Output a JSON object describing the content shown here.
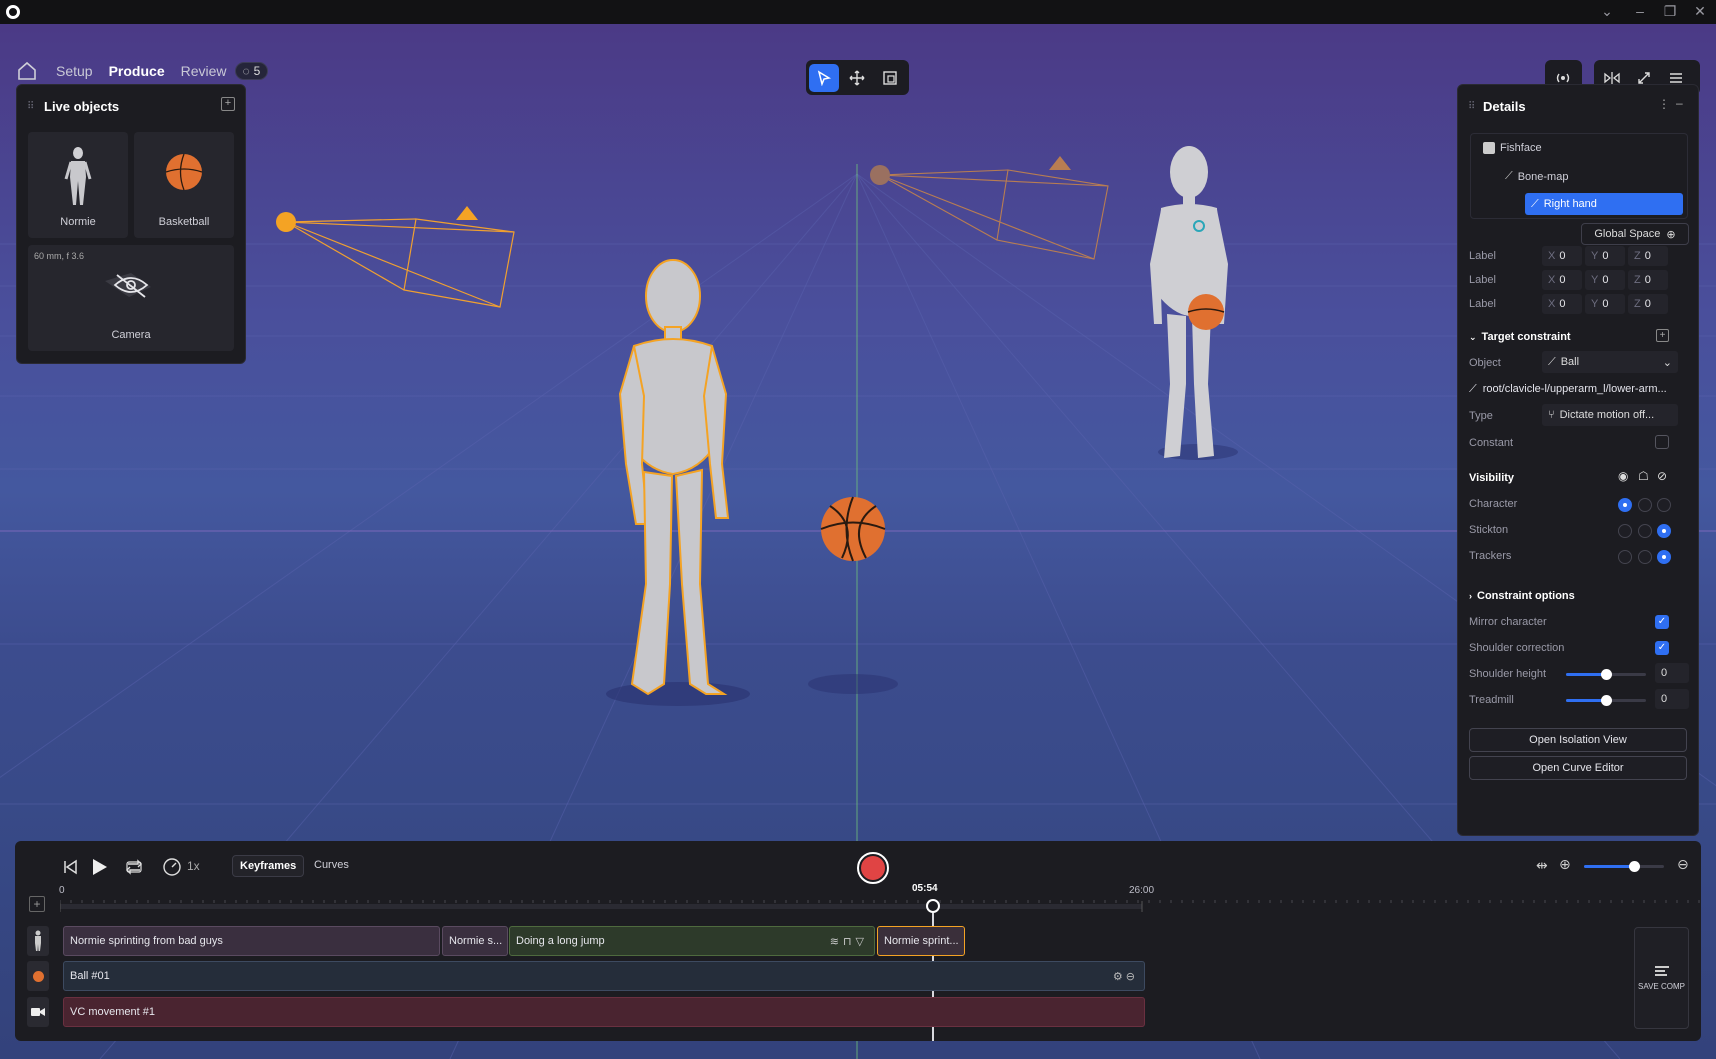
{
  "nav": {
    "tabs": [
      "Setup",
      "Produce",
      "Review"
    ],
    "active_tab": "Produce",
    "review_badge": "5"
  },
  "live_objects": {
    "title": "Live objects",
    "items": [
      {
        "label": "Normie",
        "icon": "character-figure-icon"
      },
      {
        "label": "Basketball",
        "icon": "basketball-icon"
      }
    ],
    "camera": {
      "label": "Camera",
      "lens": "60 mm, f 3.6",
      "icon": "camera-hidden-icon"
    }
  },
  "viewport": {
    "camera_markers": [
      "1",
      "1"
    ]
  },
  "details": {
    "title": "Details",
    "tree": [
      "Fishface",
      "Bone-map",
      "Right hand"
    ],
    "selected": "Right hand",
    "space_button": "Global Space",
    "transform_rows": [
      {
        "label": "Label",
        "x": "0",
        "y": "0",
        "z": "0"
      },
      {
        "label": "Label",
        "x": "0",
        "y": "0",
        "z": "0"
      },
      {
        "label": "Label",
        "x": "0",
        "y": "0",
        "z": "0"
      }
    ],
    "axis_labels": {
      "x": "X",
      "y": "Y",
      "z": "Z"
    },
    "target_constraint": {
      "title": "Target constraint",
      "object_label": "Object",
      "object_value": "Ball",
      "path": "root/clavicle-l/upperarm_l/lower-arm...",
      "type_label": "Type",
      "type_value": "Dictate motion off...",
      "constant_label": "Constant",
      "constant_checked": false
    },
    "visibility": {
      "title": "Visibility",
      "rows": [
        {
          "label": "Character",
          "selected": 0
        },
        {
          "label": "Stickton",
          "selected": 2
        },
        {
          "label": "Trackers",
          "selected": 2
        }
      ]
    },
    "constraint_options": {
      "title": "Constraint options",
      "mirror_label": "Mirror character",
      "mirror_checked": true,
      "shoulder_label": "Shoulder correction",
      "shoulder_checked": true,
      "shoulder_height_label": "Shoulder height",
      "shoulder_height_value": "0",
      "shoulder_height_level": 0.5,
      "treadmill_label": "Treadmill",
      "treadmill_value": "0",
      "treadmill_level": 0.5
    },
    "buttons": {
      "isolation": "Open Isolation View",
      "curve": "Open Curve Editor"
    }
  },
  "timeline": {
    "speed": "1x",
    "tabs": [
      "Keyframes",
      "Curves"
    ],
    "active_tab": "Keyframes",
    "ruler_start": "0",
    "playhead": "05:54",
    "ruler_end": "26:00",
    "zoom_level": 0.63,
    "tracks": [
      {
        "icon": "character-icon",
        "clips": [
          {
            "label": "Normie sprinting from bad guys",
            "color": "#3a2f3f"
          },
          {
            "label": "Normie s...",
            "color": "#3a2f3f"
          },
          {
            "label": "Doing a long jump",
            "color": "#2d3a2a"
          },
          {
            "label": "Normie sprint...",
            "color": "#3a2f3a"
          }
        ]
      },
      {
        "icon": "ball-icon",
        "clips": [
          {
            "label": "Ball #01",
            "color": "#252d3a"
          }
        ]
      },
      {
        "icon": "video-camera-icon",
        "clips": [
          {
            "label": "VC movement #1",
            "color": "#4a2430"
          }
        ]
      }
    ],
    "save_comp": "SAVE COMP"
  },
  "colors": {
    "accent": "#2f6ff2",
    "record": "#e04444",
    "highlight": "#f4a324"
  }
}
